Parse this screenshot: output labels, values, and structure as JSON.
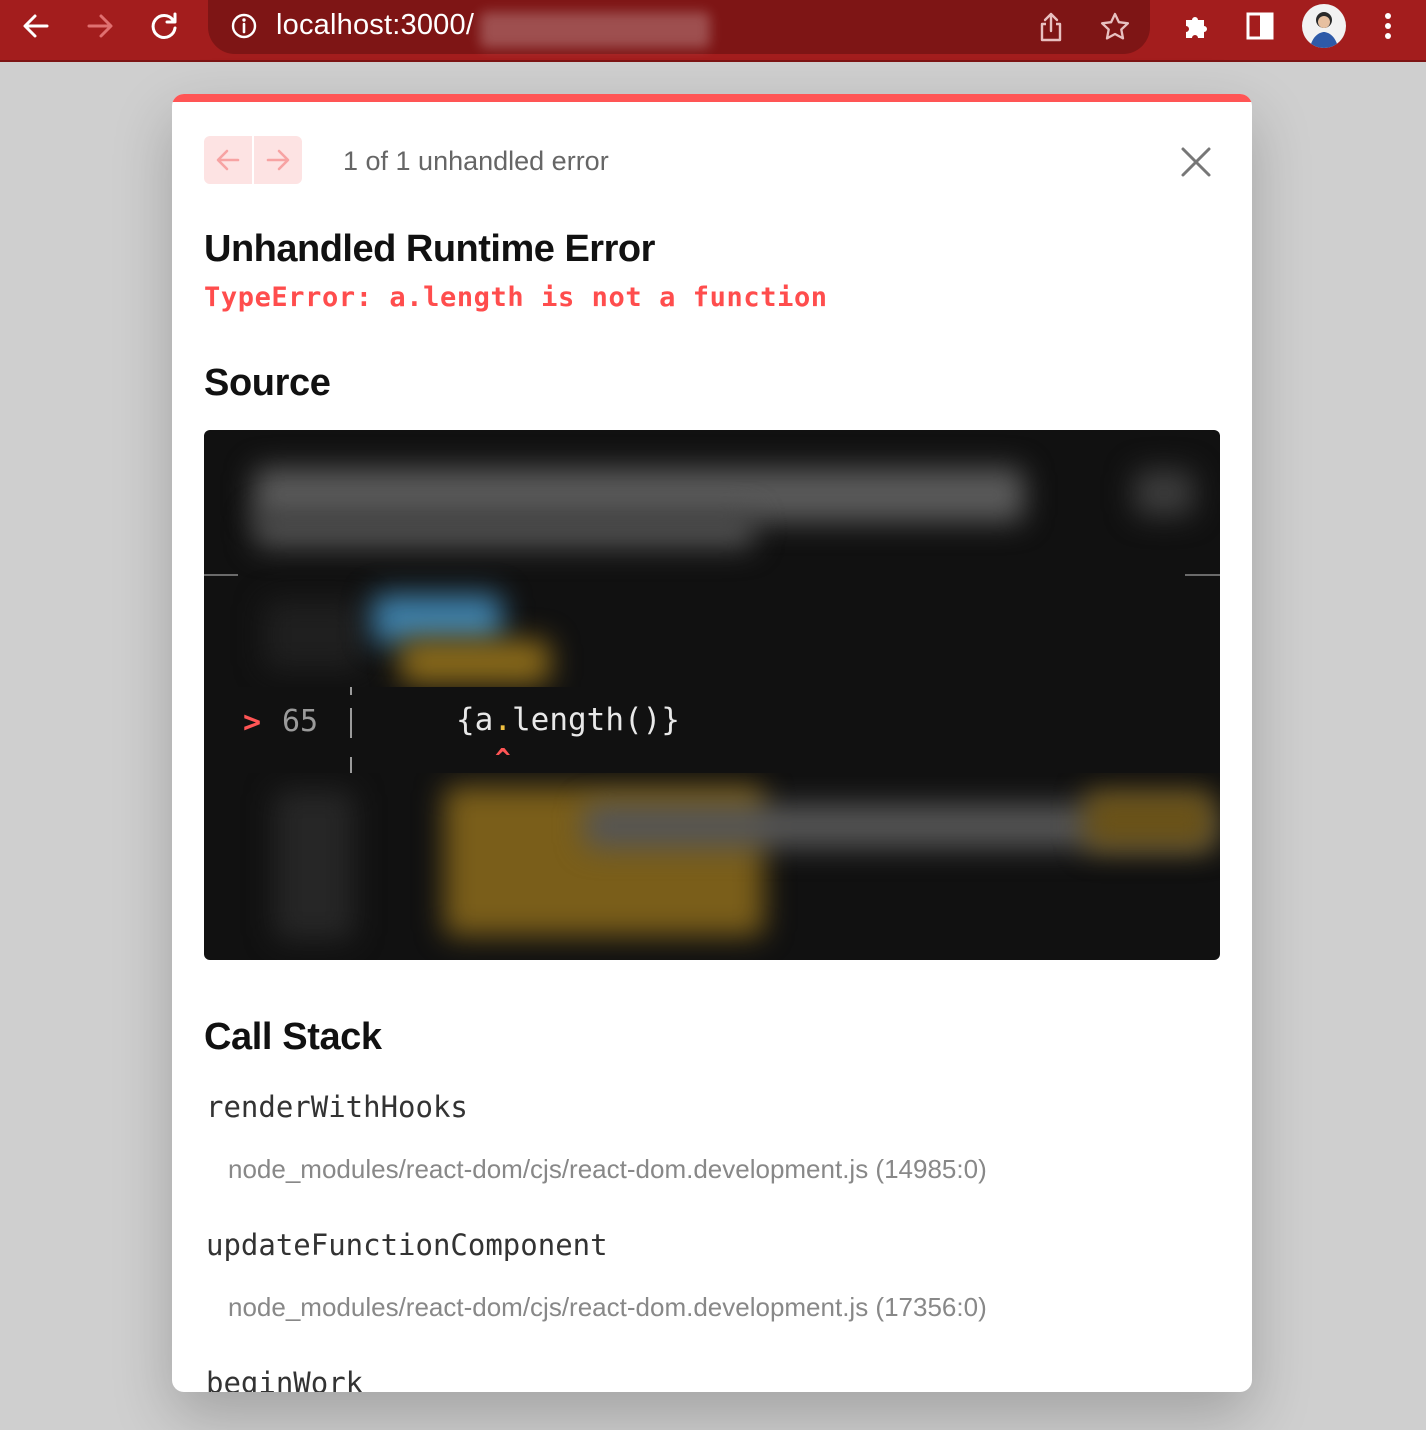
{
  "browser": {
    "url": "localhost:3000/",
    "icons": {
      "back": "arrow-left-icon",
      "forward": "arrow-right-icon",
      "reload": "reload-icon",
      "site_info": "info-icon",
      "share": "share-icon",
      "bookmark": "star-icon",
      "extensions": "puzzle-icon",
      "side_panel": "side-panel-icon",
      "profile": "avatar",
      "menu": "kebab-menu-icon"
    },
    "colors": {
      "toolbar": "#a31d1d",
      "omnibox": "#7e1515"
    }
  },
  "overlay": {
    "error_count": "1 of 1 unhandled error",
    "title": "Unhandled Runtime Error",
    "message": "TypeError: a.length is not a function",
    "source_heading": "Source",
    "source": {
      "marker": ">",
      "line_number": "65",
      "code_before": "{a",
      "code_dot": ".",
      "code_after": "length()}",
      "caret": "^"
    },
    "call_stack_heading": "Call Stack",
    "call_stack": [
      {
        "function": "renderWithHooks",
        "file": "node_modules/react-dom/cjs/react-dom.development.js (14985:0)"
      },
      {
        "function": "updateFunctionComponent",
        "file": "node_modules/react-dom/cjs/react-dom.development.js (17356:0)"
      },
      {
        "function": "beginWork",
        "file": ""
      }
    ],
    "colors": {
      "accent": "#ff5555",
      "error_text": "#ff4d4d",
      "code_bg": "#111111"
    }
  }
}
